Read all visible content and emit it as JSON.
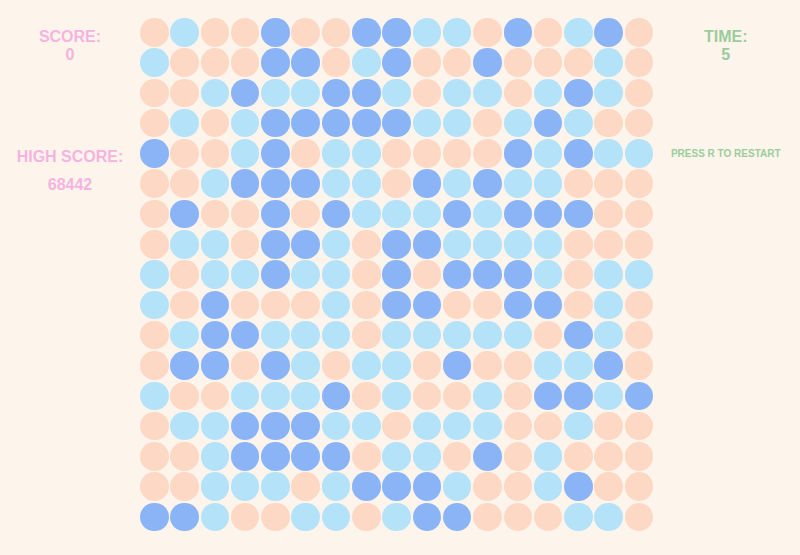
{
  "score": {
    "label": "SCORE:",
    "value": "0"
  },
  "high_score": {
    "label": "HIGH SCORE:",
    "value": "68442"
  },
  "time": {
    "label": "TIME:",
    "value": "5"
  },
  "hint": "PRESS R TO RESTART",
  "board": {
    "rows": [
      [
        "#fdd8c4",
        "#b4e2f8",
        "#fdd8c4",
        "#fdd8c4",
        "#8ab4f6",
        "#fdd8c4",
        "#fdd8c4",
        "#8ab4f6",
        "#8ab4f6",
        "#b4e2f8",
        "#b4e2f8",
        "#fdd8c4",
        "#8ab4f6",
        "#fdd8c4",
        "#b4e2f8",
        "#8ab4f6",
        "#fdd8c4"
      ],
      [
        "#b4e2f8",
        "#fdd8c4",
        "#fdd8c4",
        "#fdd8c4",
        "#8ab4f6",
        "#8ab4f6",
        "#fdd8c4",
        "#b4e2f8",
        "#8ab4f6",
        "#fdd8c4",
        "#fdd8c4",
        "#8ab4f6",
        "#fdd8c4",
        "#fdd8c4",
        "#fdd8c4",
        "#b4e2f8",
        "#fdd8c4"
      ],
      [
        "#fdd8c4",
        "#fdd8c4",
        "#b4e2f8",
        "#8ab4f6",
        "#b4e2f8",
        "#b4e2f8",
        "#8ab4f6",
        "#8ab4f6",
        "#b4e2f8",
        "#fdd8c4",
        "#b4e2f8",
        "#b4e2f8",
        "#fdd8c4",
        "#b4e2f8",
        "#8ab4f6",
        "#b4e2f8",
        "#fdd8c4"
      ],
      [
        "#fdd8c4",
        "#b4e2f8",
        "#fdd8c4",
        "#b4e2f8",
        "#8ab4f6",
        "#8ab4f6",
        "#8ab4f6",
        "#8ab4f6",
        "#8ab4f6",
        "#b4e2f8",
        "#b4e2f8",
        "#fdd8c4",
        "#b4e2f8",
        "#8ab4f6",
        "#b4e2f8",
        "#fdd8c4",
        "#fdd8c4"
      ],
      [
        "#8ab4f6",
        "#fdd8c4",
        "#fdd8c4",
        "#b4e2f8",
        "#8ab4f6",
        "#fdd8c4",
        "#b4e2f8",
        "#b4e2f8",
        "#fdd8c4",
        "#fdd8c4",
        "#fdd8c4",
        "#fdd8c4",
        "#8ab4f6",
        "#b4e2f8",
        "#8ab4f6",
        "#b4e2f8",
        "#b4e2f8"
      ],
      [
        "#fdd8c4",
        "#fdd8c4",
        "#b4e2f8",
        "#8ab4f6",
        "#8ab4f6",
        "#8ab4f6",
        "#b4e2f8",
        "#b4e2f8",
        "#fdd8c4",
        "#8ab4f6",
        "#b4e2f8",
        "#8ab4f6",
        "#b4e2f8",
        "#b4e2f8",
        "#fdd8c4",
        "#fdd8c4",
        "#fdd8c4"
      ],
      [
        "#fdd8c4",
        "#8ab4f6",
        "#fdd8c4",
        "#fdd8c4",
        "#8ab4f6",
        "#fdd8c4",
        "#8ab4f6",
        "#b4e2f8",
        "#b4e2f8",
        "#b4e2f8",
        "#8ab4f6",
        "#b4e2f8",
        "#8ab4f6",
        "#8ab4f6",
        "#8ab4f6",
        "#fdd8c4",
        "#fdd8c4"
      ],
      [
        "#fdd8c4",
        "#b4e2f8",
        "#b4e2f8",
        "#fdd8c4",
        "#8ab4f6",
        "#8ab4f6",
        "#b4e2f8",
        "#fdd8c4",
        "#8ab4f6",
        "#8ab4f6",
        "#b4e2f8",
        "#b4e2f8",
        "#b4e2f8",
        "#b4e2f8",
        "#fdd8c4",
        "#fdd8c4",
        "#fdd8c4"
      ],
      [
        "#b4e2f8",
        "#fdd8c4",
        "#b4e2f8",
        "#b4e2f8",
        "#8ab4f6",
        "#b4e2f8",
        "#b4e2f8",
        "#fdd8c4",
        "#8ab4f6",
        "#fdd8c4",
        "#8ab4f6",
        "#8ab4f6",
        "#8ab4f6",
        "#b4e2f8",
        "#fdd8c4",
        "#b4e2f8",
        "#b4e2f8"
      ],
      [
        "#b4e2f8",
        "#fdd8c4",
        "#8ab4f6",
        "#fdd8c4",
        "#fdd8c4",
        "#fdd8c4",
        "#b4e2f8",
        "#fdd8c4",
        "#8ab4f6",
        "#8ab4f6",
        "#fdd8c4",
        "#fdd8c4",
        "#8ab4f6",
        "#8ab4f6",
        "#fdd8c4",
        "#b4e2f8",
        "#fdd8c4"
      ],
      [
        "#fdd8c4",
        "#b4e2f8",
        "#8ab4f6",
        "#8ab4f6",
        "#b4e2f8",
        "#b4e2f8",
        "#b4e2f8",
        "#fdd8c4",
        "#b4e2f8",
        "#b4e2f8",
        "#b4e2f8",
        "#b4e2f8",
        "#b4e2f8",
        "#fdd8c4",
        "#8ab4f6",
        "#b4e2f8",
        "#fdd8c4"
      ],
      [
        "#fdd8c4",
        "#8ab4f6",
        "#8ab4f6",
        "#fdd8c4",
        "#8ab4f6",
        "#b4e2f8",
        "#fdd8c4",
        "#b4e2f8",
        "#b4e2f8",
        "#fdd8c4",
        "#8ab4f6",
        "#fdd8c4",
        "#fdd8c4",
        "#b4e2f8",
        "#b4e2f8",
        "#8ab4f6",
        "#fdd8c4"
      ],
      [
        "#b4e2f8",
        "#fdd8c4",
        "#fdd8c4",
        "#b4e2f8",
        "#b4e2f8",
        "#b4e2f8",
        "#8ab4f6",
        "#fdd8c4",
        "#b4e2f8",
        "#fdd8c4",
        "#fdd8c4",
        "#b4e2f8",
        "#fdd8c4",
        "#8ab4f6",
        "#8ab4f6",
        "#b4e2f8",
        "#8ab4f6"
      ],
      [
        "#fdd8c4",
        "#b4e2f8",
        "#b4e2f8",
        "#8ab4f6",
        "#8ab4f6",
        "#8ab4f6",
        "#b4e2f8",
        "#b4e2f8",
        "#fdd8c4",
        "#b4e2f8",
        "#b4e2f8",
        "#b4e2f8",
        "#fdd8c4",
        "#fdd8c4",
        "#b4e2f8",
        "#fdd8c4",
        "#fdd8c4"
      ],
      [
        "#fdd8c4",
        "#fdd8c4",
        "#b4e2f8",
        "#8ab4f6",
        "#8ab4f6",
        "#8ab4f6",
        "#8ab4f6",
        "#fdd8c4",
        "#b4e2f8",
        "#b4e2f8",
        "#fdd8c4",
        "#8ab4f6",
        "#fdd8c4",
        "#b4e2f8",
        "#fdd8c4",
        "#fdd8c4",
        "#fdd8c4"
      ],
      [
        "#fdd8c4",
        "#fdd8c4",
        "#b4e2f8",
        "#b4e2f8",
        "#b4e2f8",
        "#fdd8c4",
        "#b4e2f8",
        "#8ab4f6",
        "#8ab4f6",
        "#8ab4f6",
        "#b4e2f8",
        "#fdd8c4",
        "#fdd8c4",
        "#b4e2f8",
        "#8ab4f6",
        "#fdd8c4",
        "#fdd8c4"
      ],
      [
        "#8ab4f6",
        "#8ab4f6",
        "#b4e2f8",
        "#fdd8c4",
        "#fdd8c4",
        "#b4e2f8",
        "#b4e2f8",
        "#fdd8c4",
        "#b4e2f8",
        "#8ab4f6",
        "#8ab4f6",
        "#fdd8c4",
        "#fdd8c4",
        "#fdd8c4",
        "#b4e2f8",
        "#b4e2f8",
        "#fdd8c4"
      ]
    ]
  }
}
